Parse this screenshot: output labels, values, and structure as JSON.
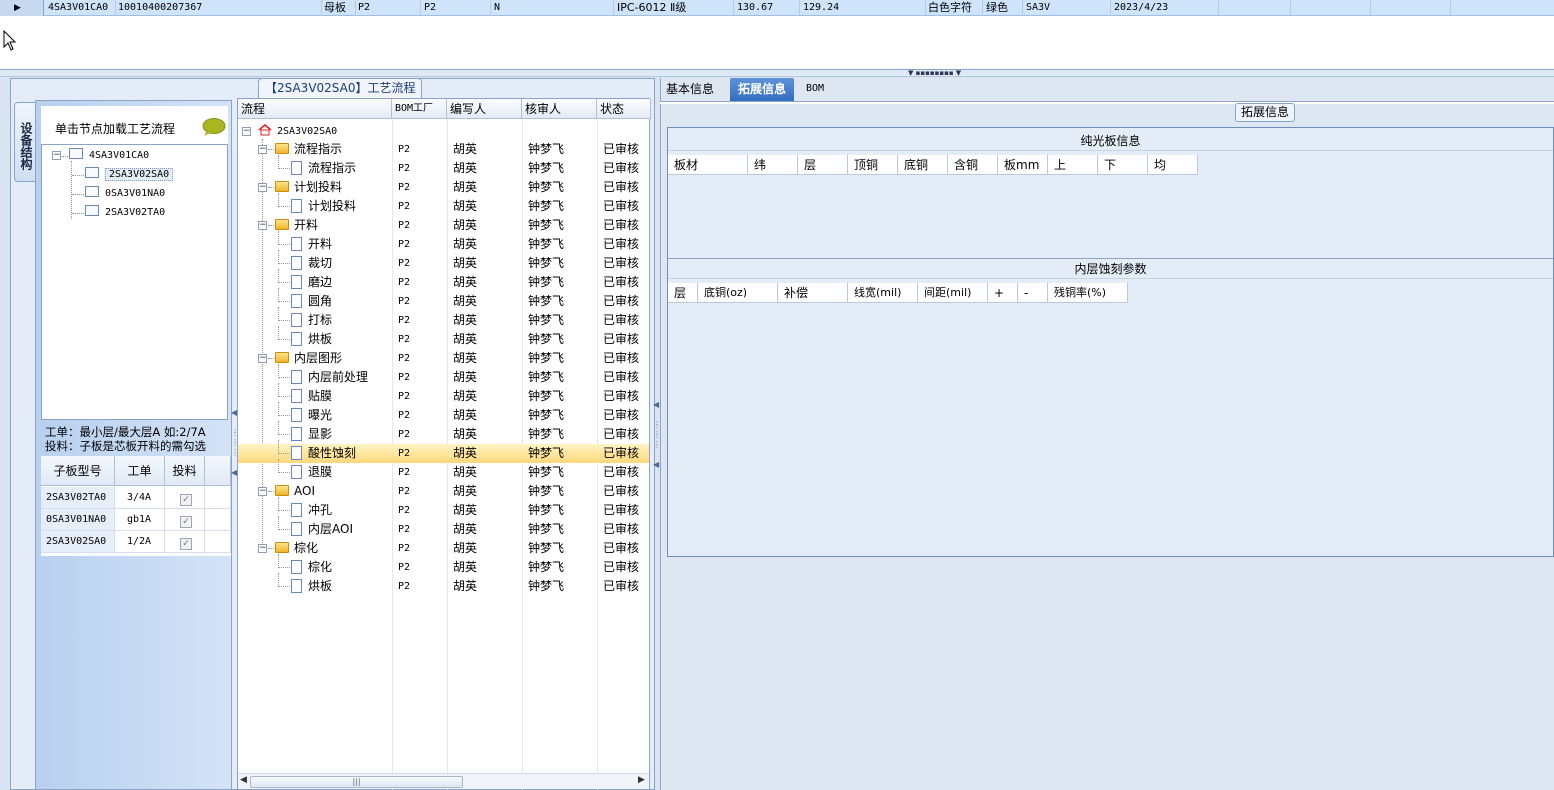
{
  "top_row": {
    "indicator": "▶",
    "cells": [
      {
        "text": "4SA3V01CA0",
        "mono": true
      },
      {
        "text": "10010400207367",
        "mono": true
      },
      {
        "text": "母板",
        "mono": false
      },
      {
        "text": "P2",
        "mono": true
      },
      {
        "text": "P2",
        "mono": true
      },
      {
        "text": "N",
        "mono": true
      },
      {
        "text": "IPC-6012 Ⅱ级",
        "mono": false
      },
      {
        "text": "130.67",
        "mono": true
      },
      {
        "text": "129.24",
        "mono": true
      },
      {
        "text": "白色字符",
        "mono": false
      },
      {
        "text": "绿色",
        "mono": false
      },
      {
        "text": "SA3V",
        "mono": true
      },
      {
        "text": "2023/4/23",
        "mono": true
      }
    ]
  },
  "process_title": "【2SA3V02SA0】工艺流程",
  "side_tab": "设备结构",
  "structure": {
    "header": "单击节点加载工艺流程",
    "tree": [
      {
        "label": "4SA3V01CA0",
        "level": 0,
        "expanded": true,
        "selected": false
      },
      {
        "label": "2SA3V02SA0",
        "level": 1,
        "selected": true
      },
      {
        "label": "0SA3V01NA0",
        "level": 1,
        "selected": false
      },
      {
        "label": "2SA3V02TA0",
        "level": 1,
        "selected": false
      }
    ],
    "note_line1": "工单：最小层/最大层A 如:2/7A",
    "note_line2": "投料：子板是芯板开料的需勾选",
    "grid": {
      "headers": [
        "子板型号",
        "工单",
        "投料"
      ],
      "rows": [
        {
          "model": "2SA3V02TA0",
          "order": "3/4A",
          "feed": true
        },
        {
          "model": "0SA3V01NA0",
          "order": "gb1A",
          "feed": true
        },
        {
          "model": "2SA3V02SA0",
          "order": "1/2A",
          "feed": true
        }
      ]
    }
  },
  "process": {
    "headers": [
      "流程",
      "BOM工厂",
      "编写人",
      "核审人",
      "状态"
    ],
    "root": "2SA3V02SA0",
    "rows": [
      {
        "name": "流程指示",
        "type": "folder",
        "bom": "P2",
        "writer": "胡英",
        "reviewer": "钟梦飞",
        "status": "已审核"
      },
      {
        "name": "流程指示",
        "type": "doc",
        "bom": "P2",
        "writer": "胡英",
        "reviewer": "钟梦飞",
        "status": "已审核"
      },
      {
        "name": "计划投料",
        "type": "folder",
        "bom": "P2",
        "writer": "胡英",
        "reviewer": "钟梦飞",
        "status": "已审核"
      },
      {
        "name": "计划投料",
        "type": "doc",
        "bom": "P2",
        "writer": "胡英",
        "reviewer": "钟梦飞",
        "status": "已审核"
      },
      {
        "name": "开料",
        "type": "folder",
        "bom": "P2",
        "writer": "胡英",
        "reviewer": "钟梦飞",
        "status": "已审核"
      },
      {
        "name": "开料",
        "type": "doc",
        "bom": "P2",
        "writer": "胡英",
        "reviewer": "钟梦飞",
        "status": "已审核"
      },
      {
        "name": "裁切",
        "type": "doc",
        "bom": "P2",
        "writer": "胡英",
        "reviewer": "钟梦飞",
        "status": "已审核"
      },
      {
        "name": "磨边",
        "type": "doc",
        "bom": "P2",
        "writer": "胡英",
        "reviewer": "钟梦飞",
        "status": "已审核"
      },
      {
        "name": "圆角",
        "type": "doc",
        "bom": "P2",
        "writer": "胡英",
        "reviewer": "钟梦飞",
        "status": "已审核"
      },
      {
        "name": "打标",
        "type": "doc",
        "bom": "P2",
        "writer": "胡英",
        "reviewer": "钟梦飞",
        "status": "已审核"
      },
      {
        "name": "烘板",
        "type": "doc",
        "bom": "P2",
        "writer": "胡英",
        "reviewer": "钟梦飞",
        "status": "已审核"
      },
      {
        "name": "内层图形",
        "type": "folder",
        "bom": "P2",
        "writer": "胡英",
        "reviewer": "钟梦飞",
        "status": "已审核"
      },
      {
        "name": "内层前处理",
        "type": "doc",
        "bom": "P2",
        "writer": "胡英",
        "reviewer": "钟梦飞",
        "status": "已审核"
      },
      {
        "name": "贴膜",
        "type": "doc",
        "bom": "P2",
        "writer": "胡英",
        "reviewer": "钟梦飞",
        "status": "已审核"
      },
      {
        "name": "曝光",
        "type": "doc",
        "bom": "P2",
        "writer": "胡英",
        "reviewer": "钟梦飞",
        "status": "已审核"
      },
      {
        "name": "显影",
        "type": "doc",
        "bom": "P2",
        "writer": "胡英",
        "reviewer": "钟梦飞",
        "status": "已审核"
      },
      {
        "name": "酸性蚀刻",
        "type": "doc",
        "bom": "P2",
        "writer": "胡英",
        "reviewer": "钟梦飞",
        "status": "已审核",
        "highlight": true
      },
      {
        "name": "退膜",
        "type": "doc",
        "bom": "P2",
        "writer": "胡英",
        "reviewer": "钟梦飞",
        "status": "已审核"
      },
      {
        "name": "AOI",
        "type": "folder",
        "bom": "P2",
        "writer": "胡英",
        "reviewer": "钟梦飞",
        "status": "已审核"
      },
      {
        "name": "冲孔",
        "type": "doc",
        "bom": "P2",
        "writer": "胡英",
        "reviewer": "钟梦飞",
        "status": "已审核"
      },
      {
        "name": "内层AOI",
        "type": "doc",
        "bom": "P2",
        "writer": "胡英",
        "reviewer": "钟梦飞",
        "status": "已审核"
      },
      {
        "name": "棕化",
        "type": "folder",
        "bom": "P2",
        "writer": "胡英",
        "reviewer": "钟梦飞",
        "status": "已审核"
      },
      {
        "name": "棕化",
        "type": "doc",
        "bom": "P2",
        "writer": "胡英",
        "reviewer": "钟梦飞",
        "status": "已审核"
      },
      {
        "name": "烘板",
        "type": "doc",
        "bom": "P2",
        "writer": "胡英",
        "reviewer": "钟梦飞",
        "status": "已审核"
      }
    ]
  },
  "tabs": [
    {
      "label": "基本信息",
      "active": false
    },
    {
      "label": "拓展信息",
      "active": true
    },
    {
      "label": "BOM",
      "active": false
    }
  ],
  "ext": {
    "title": "拓展信息",
    "section1_title": "纯光板信息",
    "section1_headers": [
      "板材",
      "纬",
      "层",
      "顶铜",
      "底铜",
      "含铜",
      "板mm",
      "上",
      "下",
      "均"
    ],
    "section2_title": "内层蚀刻参数",
    "section2_headers": [
      "层",
      "底铜(oz)",
      "补偿",
      "线宽(mil)",
      "间距(mil)",
      "+",
      "-",
      "残铜率(%)"
    ]
  }
}
